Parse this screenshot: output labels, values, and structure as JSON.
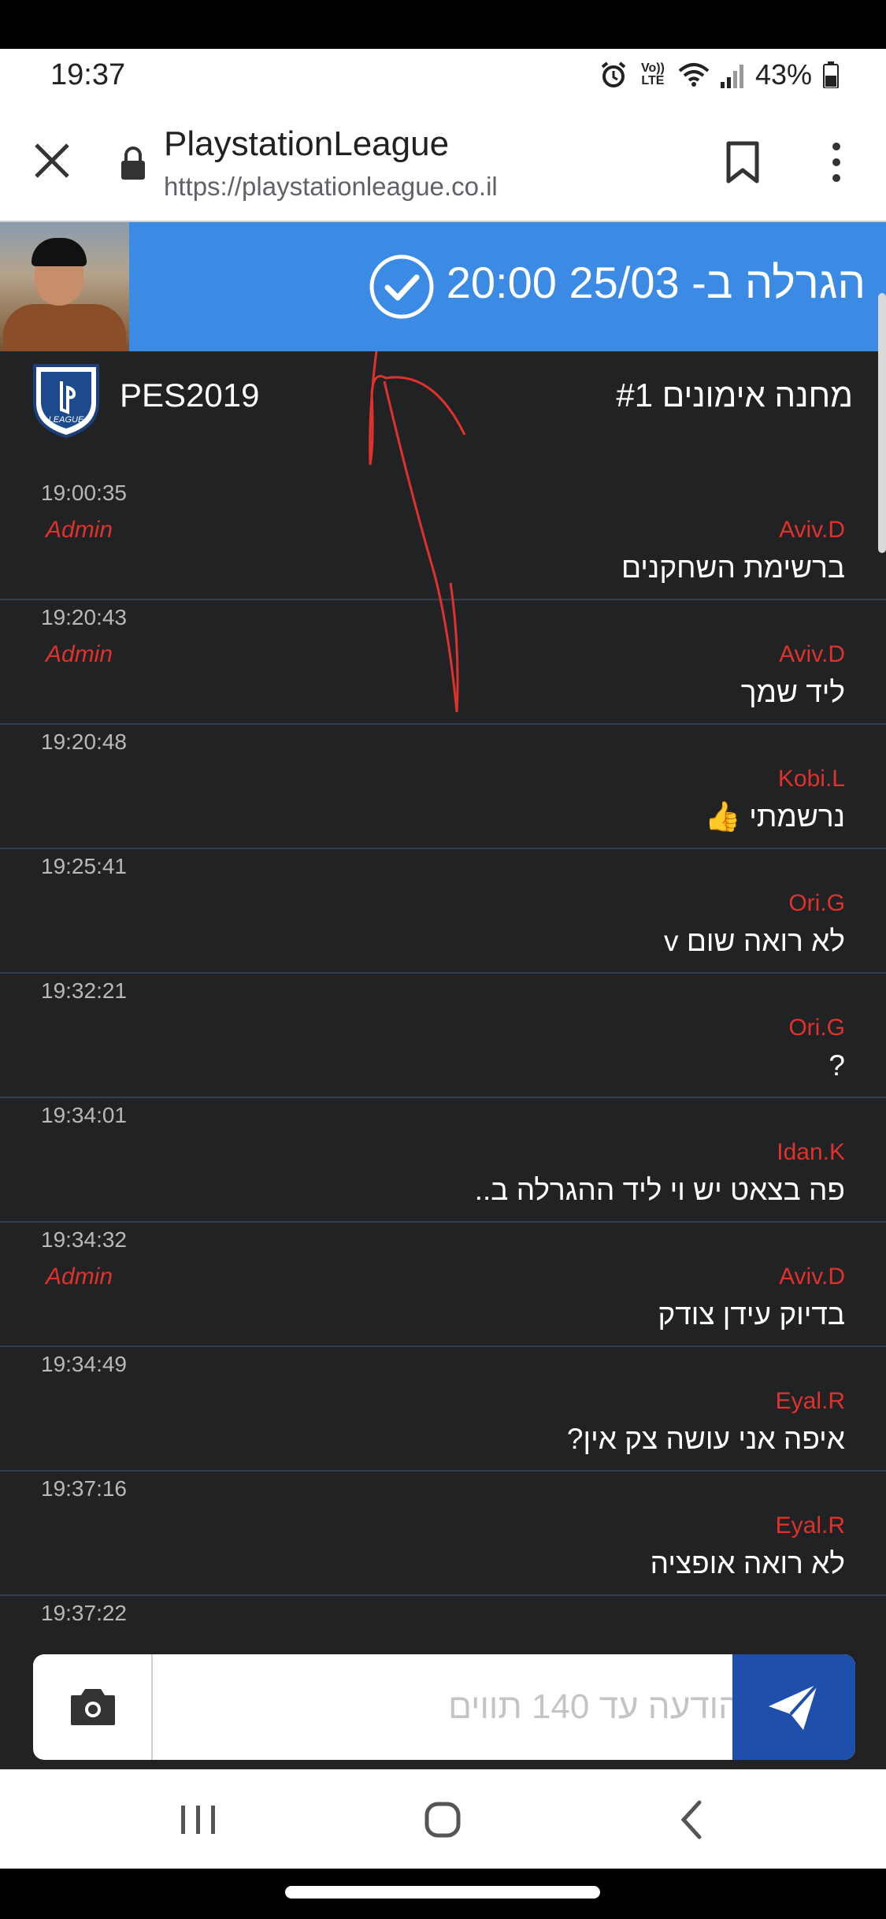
{
  "status_bar": {
    "time": "19:37",
    "network_label": "Vo)) LTE",
    "battery": "43%"
  },
  "browser": {
    "title": "PlaystationLeague",
    "url": "https://playstationleague.co.il"
  },
  "banner": {
    "text": "הגרלה ב- 25/03 20:00",
    "accent": "#3b8ae4"
  },
  "room": {
    "game": "PES2019",
    "name": "מחנה אימונים #1",
    "logo_text": "LEAGUE"
  },
  "messages": [
    {
      "time": "19:00:35",
      "user": "Aviv.D",
      "admin": "Admin",
      "text": "ברשימת השחקנים"
    },
    {
      "time": "19:20:43",
      "user": "Aviv.D",
      "admin": "Admin",
      "text": "ליד שמך"
    },
    {
      "time": "19:20:48",
      "user": "Kobi.L",
      "admin": "",
      "text": "נרשמתי 👍"
    },
    {
      "time": "19:25:41",
      "user": "Ori.G",
      "admin": "",
      "text": "לא רואה שום v"
    },
    {
      "time": "19:32:21",
      "user": "Ori.G",
      "admin": "",
      "text": "?"
    },
    {
      "time": "19:34:01",
      "user": "Idan.K",
      "admin": "",
      "text": "פה בצאט יש וי ליד ההגרלה ב.."
    },
    {
      "time": "19:34:32",
      "user": "Aviv.D",
      "admin": "Admin",
      "text": "בדיוק עידן צודק"
    },
    {
      "time": "19:34:49",
      "user": "Eyal.R",
      "admin": "",
      "text": "איפה אני עושה צק אין?"
    },
    {
      "time": "19:37:16",
      "user": "Eyal.R",
      "admin": "",
      "text": "לא רואה אופציה"
    },
    {
      "time": "19:37:22",
      "user": "",
      "admin": "",
      "text": ""
    }
  ],
  "composer": {
    "placeholder": "הודעה עד 140 תווים"
  },
  "colors": {
    "page_bg": "#212223",
    "username": "#e0312c",
    "send_button": "#1e4faa"
  }
}
